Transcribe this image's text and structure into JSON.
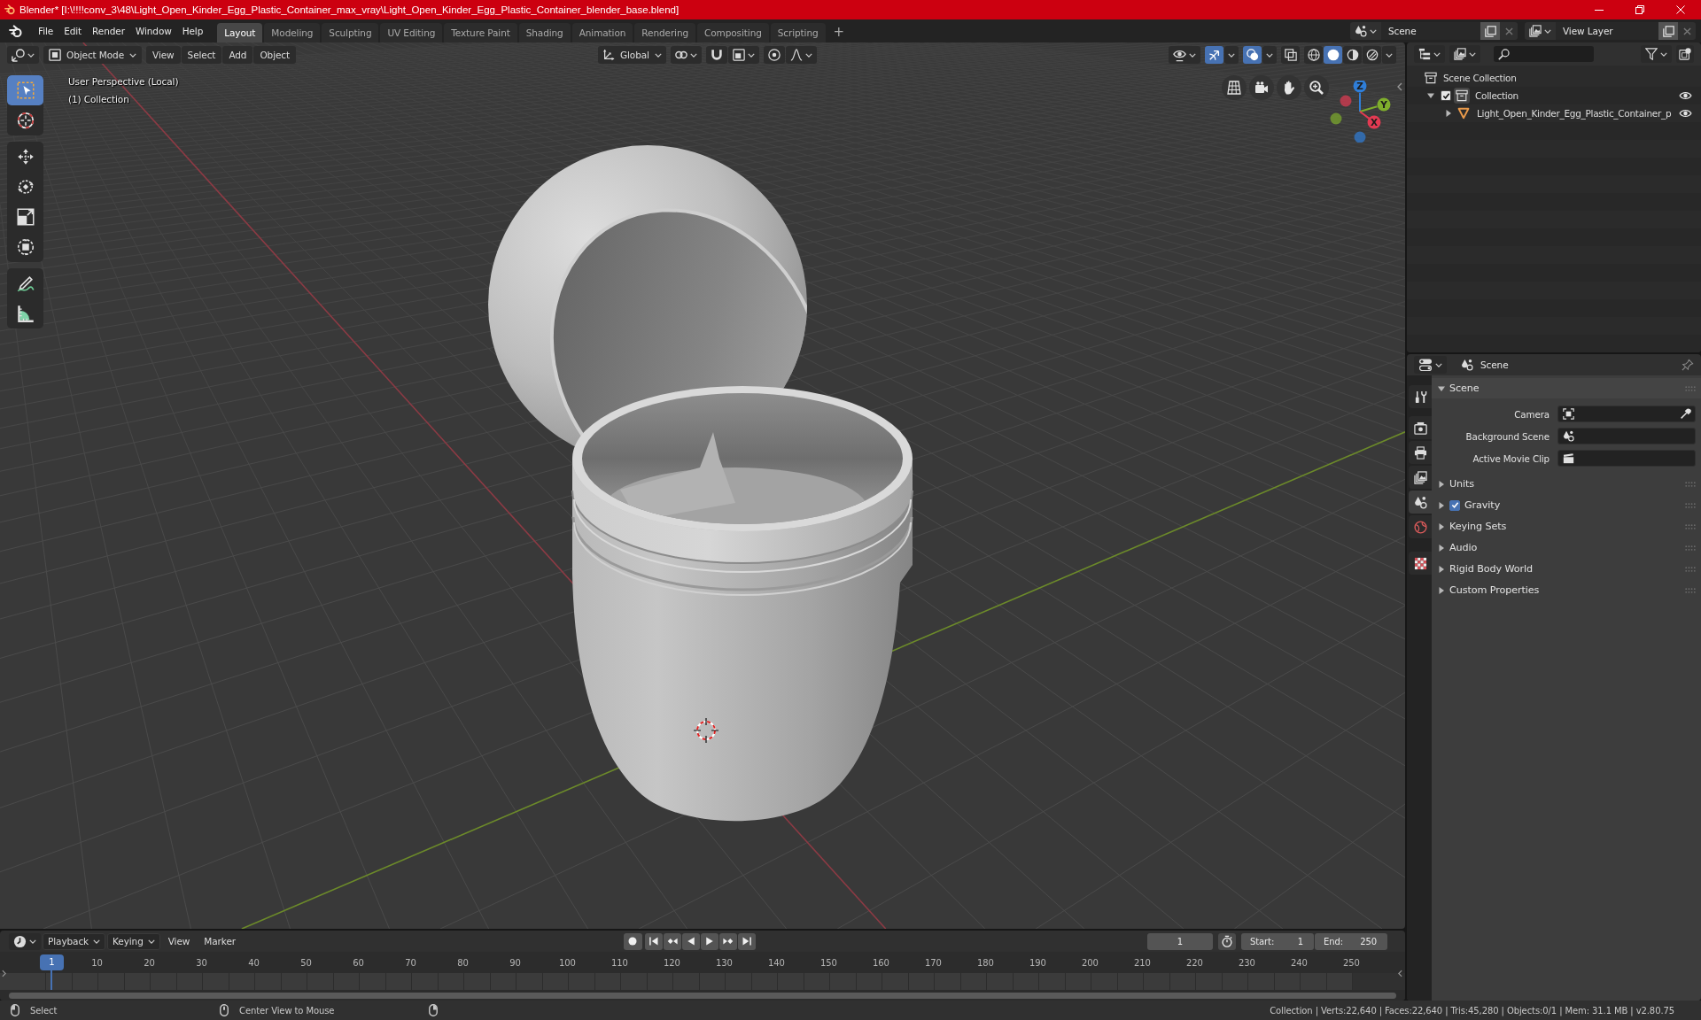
{
  "window": {
    "title": "Blender* [I:\\!!!!conv_3\\48\\Light_Open_Kinder_Egg_Plastic_Container_max_vray\\Light_Open_Kinder_Egg_Plastic_Container_blender_base.blend]"
  },
  "menu": [
    "File",
    "Edit",
    "Render",
    "Window",
    "Help"
  ],
  "workspaces": [
    {
      "label": "Layout",
      "selected": true
    },
    {
      "label": "Modeling",
      "selected": false
    },
    {
      "label": "Sculpting",
      "selected": false
    },
    {
      "label": "UV Editing",
      "selected": false
    },
    {
      "label": "Texture Paint",
      "selected": false
    },
    {
      "label": "Shading",
      "selected": false
    },
    {
      "label": "Animation",
      "selected": false
    },
    {
      "label": "Rendering",
      "selected": false
    },
    {
      "label": "Compositing",
      "selected": false
    },
    {
      "label": "Scripting",
      "selected": false
    }
  ],
  "add_workspace": "+",
  "scene": {
    "value": "Scene"
  },
  "view_layer": {
    "value": "View Layer"
  },
  "viewport": {
    "mode": "Object Mode",
    "menus": [
      "View",
      "Select",
      "Add",
      "Object"
    ],
    "orientation": "Global",
    "snap_on": false,
    "proportional_on": false,
    "gizmos_on": true,
    "overlays_on": true,
    "xray_on": false,
    "shading": [
      {
        "kind": "wireframe",
        "selected": false
      },
      {
        "kind": "solid",
        "selected": true
      },
      {
        "kind": "material",
        "selected": false
      },
      {
        "kind": "rendered",
        "selected": false
      }
    ],
    "info": [
      "User Perspective (Local)",
      "(1) Collection"
    ],
    "tools": [
      [
        {
          "kind": "select_box",
          "selected": true
        },
        {
          "kind": "cursor",
          "selected": false
        }
      ],
      [
        {
          "kind": "move",
          "selected": false
        },
        {
          "kind": "rotate",
          "selected": false
        },
        {
          "kind": "scale",
          "selected": false
        },
        {
          "kind": "transform",
          "selected": false
        }
      ],
      [
        {
          "kind": "annotate",
          "selected": false
        },
        {
          "kind": "measure",
          "selected": false
        }
      ]
    ],
    "gizmo_axes": [
      {
        "label": "Z",
        "color": "#2f7ed8"
      },
      {
        "label": "Y",
        "color": "#7fae2c"
      },
      {
        "label": "X",
        "color": "#e23a52"
      }
    ]
  },
  "outliner": {
    "items": [
      {
        "label": "Scene Collection",
        "kind": "scene_collection",
        "active": false,
        "children": [
          {
            "label": "Collection",
            "kind": "collection",
            "active": true,
            "expanded": true,
            "checked": true,
            "visible": true,
            "children": [
              {
                "label": "Light_Open_Kinder_Egg_Plastic_Container_p",
                "kind": "mesh",
                "active": false,
                "expanded": false,
                "visible": true
              }
            ]
          }
        ]
      }
    ]
  },
  "properties": {
    "context": "Scene",
    "tabs": [
      [
        {
          "kind": "tool",
          "selected": false
        }
      ],
      [
        {
          "kind": "render",
          "selected": false
        },
        {
          "kind": "output",
          "selected": false
        },
        {
          "kind": "view_layer",
          "selected": false
        },
        {
          "kind": "scene",
          "selected": true
        },
        {
          "kind": "world",
          "selected": false
        }
      ],
      [
        {
          "kind": "texture",
          "selected": false
        }
      ]
    ],
    "panels": [
      {
        "title": "Scene",
        "kind": "plain",
        "expanded": true,
        "fields": [
          {
            "label": "Camera",
            "kind": "camera"
          },
          {
            "label": "Background Scene",
            "kind": "scene"
          },
          {
            "label": "Active Movie Clip",
            "kind": "clip"
          }
        ]
      },
      {
        "title": "Units",
        "kind": "plain",
        "expanded": false
      },
      {
        "title": "Gravity",
        "kind": "toggle",
        "expanded": false,
        "checked": true
      },
      {
        "title": "Keying Sets",
        "kind": "plain",
        "expanded": false
      },
      {
        "title": "Audio",
        "kind": "plain",
        "expanded": false
      },
      {
        "title": "Rigid Body World",
        "kind": "plain",
        "expanded": false
      },
      {
        "title": "Custom Properties",
        "kind": "plain",
        "expanded": false
      }
    ]
  },
  "timeline": {
    "menus": [
      {
        "label": "Playback",
        "kind": "dropdown"
      },
      {
        "label": "Keying",
        "kind": "dropdown"
      },
      {
        "label": "View",
        "kind": "menu"
      },
      {
        "label": "Marker",
        "kind": "menu"
      }
    ],
    "current_frame": "1",
    "start": {
      "label": "Start:",
      "value": "1"
    },
    "end": {
      "label": "End:",
      "value": "250"
    },
    "playhead": "1",
    "ruler": [
      "10",
      "20",
      "30",
      "40",
      "50",
      "60",
      "70",
      "80",
      "90",
      "100",
      "110",
      "120",
      "130",
      "140",
      "150",
      "160",
      "170",
      "180",
      "190",
      "200",
      "210",
      "220",
      "230",
      "240",
      "250"
    ]
  },
  "status_bar": {
    "hints": [
      {
        "kind": "left",
        "label": "Select"
      },
      {
        "kind": "middle",
        "label": "Center View to Mouse"
      },
      {
        "kind": "right"
      }
    ],
    "stats": "Collection | Verts:22,640 | Faces:22,640 | Tris:45,280 | Objects:0/1 | Mem: 31.1 MB | v2.80.75"
  }
}
